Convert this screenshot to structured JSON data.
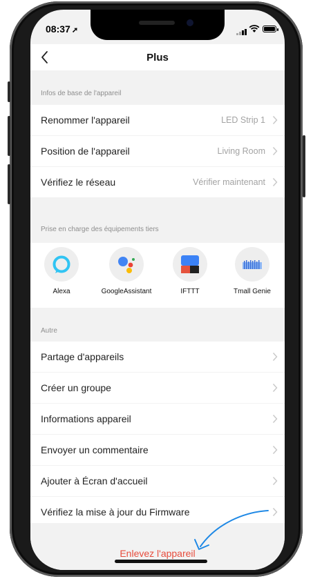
{
  "status_bar": {
    "time": "08:37",
    "time_arrow": "➚"
  },
  "header": {
    "title": "Plus"
  },
  "basic_info": {
    "heading": "Infos de base de l'appareil",
    "rows": [
      {
        "label": "Renommer l'appareil",
        "value": "LED Strip 1"
      },
      {
        "label": "Position de l'appareil",
        "value": "Living Room"
      },
      {
        "label": "Vérifiez le réseau",
        "value": "Vérifier maintenant"
      }
    ]
  },
  "third_party": {
    "heading": "Prise en charge des équipements tiers",
    "items": [
      {
        "name": "Alexa",
        "icon": "alexa-icon"
      },
      {
        "name": "GoogleAssistant",
        "icon": "google-assistant-icon"
      },
      {
        "name": "IFTTT",
        "icon": "ifttt-icon"
      },
      {
        "name": "Tmall Genie",
        "icon": "tmall-genie-icon"
      }
    ]
  },
  "other": {
    "heading": "Autre",
    "rows": [
      {
        "label": "Partage d'appareils"
      },
      {
        "label": "Créer un groupe"
      },
      {
        "label": "Informations appareil"
      },
      {
        "label": "Envoyer un commentaire"
      },
      {
        "label": "Ajouter à Écran d'accueil"
      },
      {
        "label": "Vérifiez la mise à jour du Firmware"
      }
    ]
  },
  "footer": {
    "remove_label": "Enlevez l'appareil"
  },
  "colors": {
    "accent_red": "#e74c3c",
    "annotation_blue": "#1e88e5",
    "alexa_blue": "#31c4f3",
    "ifttt_blue": "#3b82f6"
  }
}
